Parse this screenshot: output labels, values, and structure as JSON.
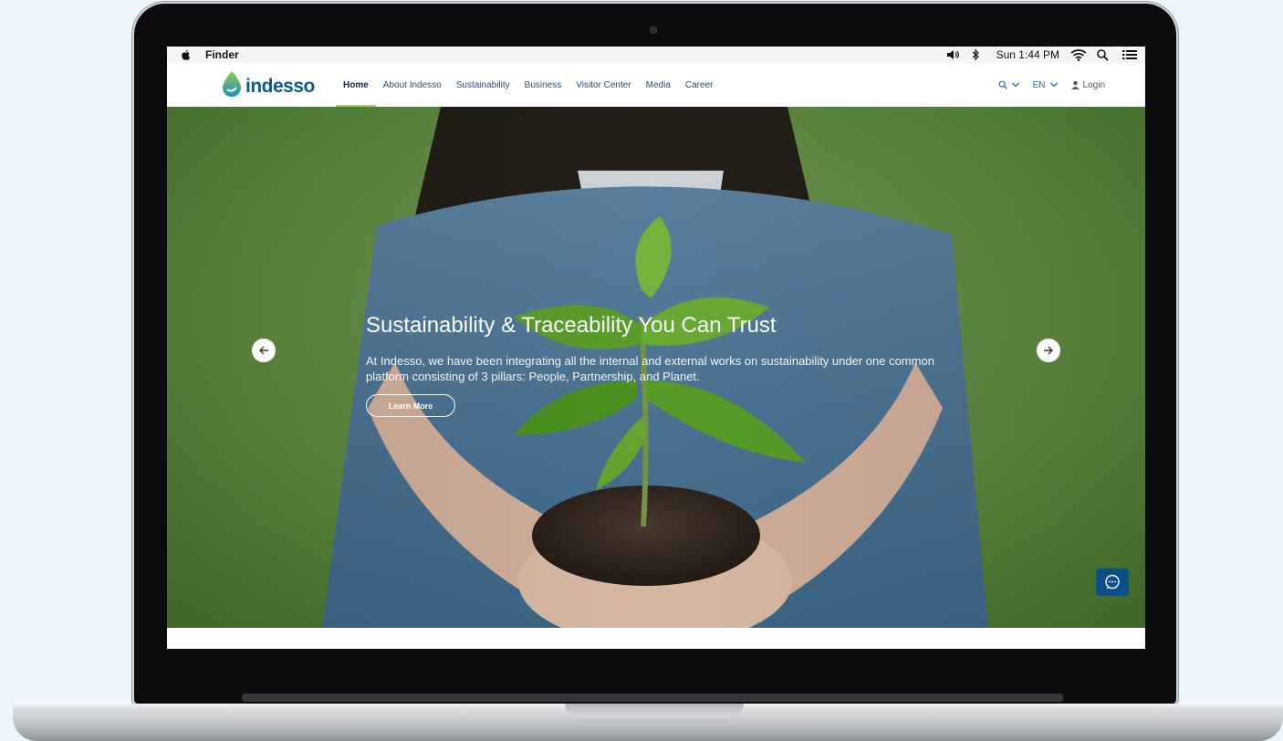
{
  "menubar": {
    "app_name": "Finder",
    "clock": "Sun 1:44 PM"
  },
  "site": {
    "logo_text": "indesso",
    "nav": [
      {
        "label": "Home",
        "active": true
      },
      {
        "label": "About Indesso",
        "active": false
      },
      {
        "label": "Sustainability",
        "active": false
      },
      {
        "label": "Business",
        "active": false
      },
      {
        "label": "Visitor Center",
        "active": false
      },
      {
        "label": "Media",
        "active": false
      },
      {
        "label": "Career",
        "active": false
      }
    ],
    "language": "EN",
    "login_label": "Login"
  },
  "hero": {
    "title": "Sustainability & Traceability You Can Trust",
    "description": "At Indesso, we have been integrating all the internal and external works on sustainability under one common platform consisting of 3 pillars: People, Partnership, and Planet.",
    "cta_label": "Learn More"
  },
  "colors": {
    "brand_blue": "#0b5a8f",
    "nav_text": "#1e4e7a",
    "active_underline": "#9ad06e",
    "chat_button": "#0b4f8a"
  },
  "icons": [
    "apple-icon",
    "volume-icon",
    "bluetooth-icon",
    "wifi-icon",
    "spotlight-search-icon",
    "control-center-icon",
    "logo-drop-icon",
    "search-icon",
    "chevron-down-icon",
    "user-icon",
    "arrow-left-icon",
    "arrow-right-icon",
    "chat-icon"
  ]
}
